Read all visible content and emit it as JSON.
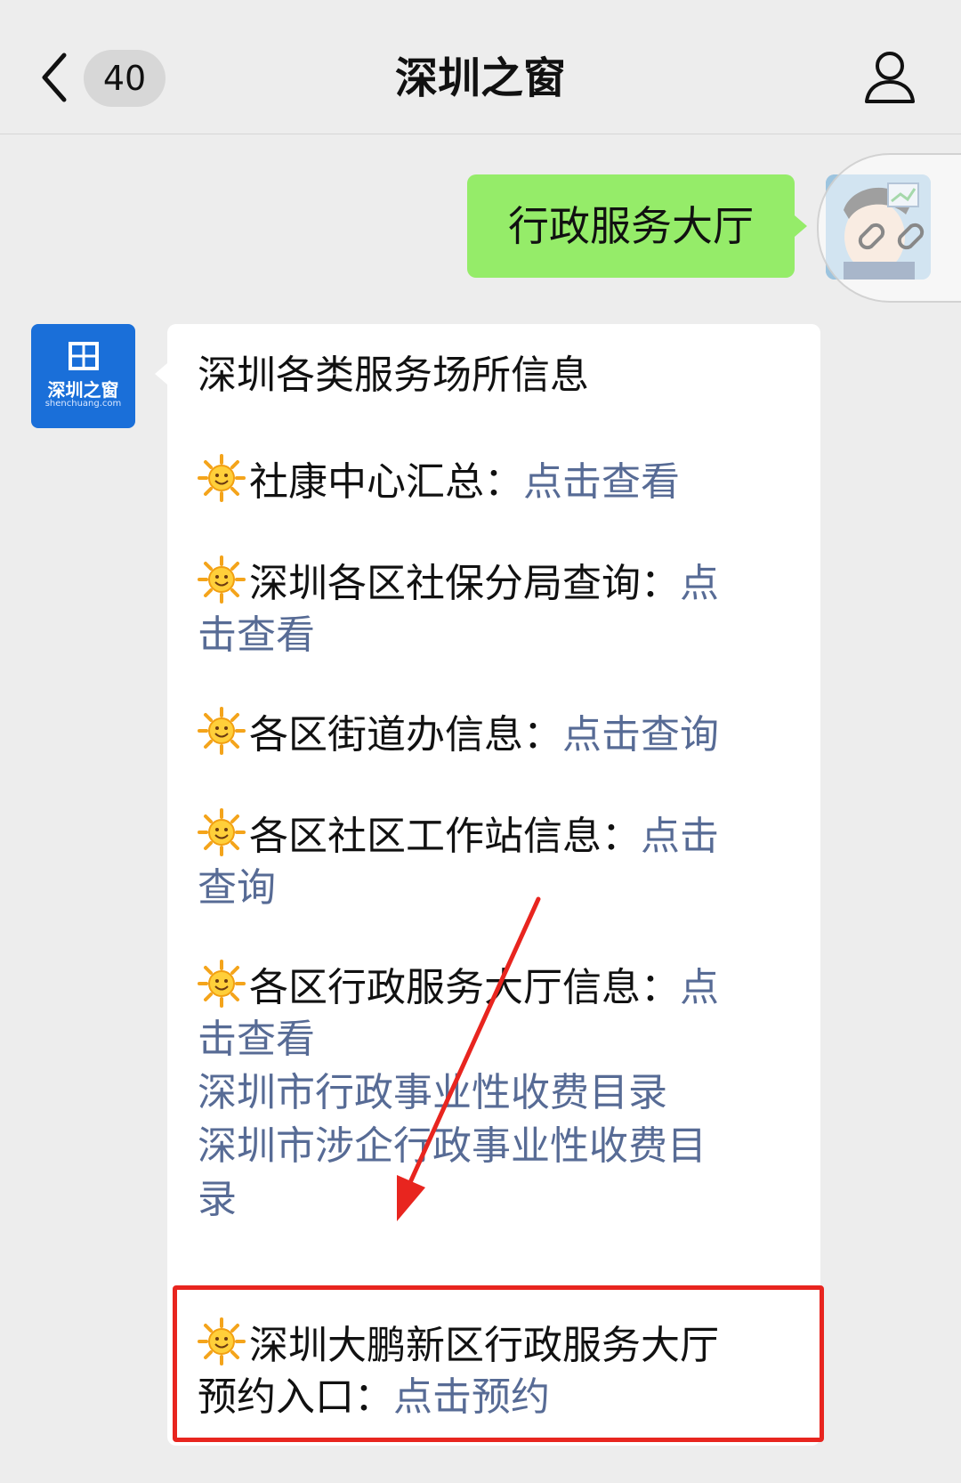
{
  "header": {
    "back_label": "返回",
    "unread_count": "40",
    "title": "深圳之窗"
  },
  "messages": {
    "outgoing_text": "行政服务大厅",
    "sender_avatar": {
      "main": "深圳之窗",
      "sub": "shenchuang.com"
    },
    "incoming": {
      "heading": "深圳各类服务场所信息",
      "items": [
        {
          "label": "社康中心汇总：",
          "link": "点击查看"
        },
        {
          "label": "深圳各区社保分局查询：",
          "link_line1": "点",
          "link_line2": "击查看"
        },
        {
          "label": "各区街道办信息：",
          "link": "点击查询"
        },
        {
          "label": "各区社区工作站信息：",
          "link_line1": "点击",
          "link_line2": "查询"
        },
        {
          "label": "各区行政服务大厅信息：",
          "link_line1": "点",
          "link_line2": "击查看"
        }
      ],
      "extra_links": {
        "fee_catalog": "深圳市行政事业性收费目录",
        "enterprise_fee_line1": "深圳市涉企行政事业性收费目",
        "enterprise_fee_line2": "录"
      },
      "highlight": {
        "label_line1": "深圳大鹏新区行政服务大厅",
        "label_line2": "预约入口：",
        "link": "点击预约"
      }
    }
  },
  "colors": {
    "link": "#576b95",
    "outgoing_bubble": "#95ec69",
    "highlight_border": "#e8251f",
    "background": "#ededed"
  }
}
